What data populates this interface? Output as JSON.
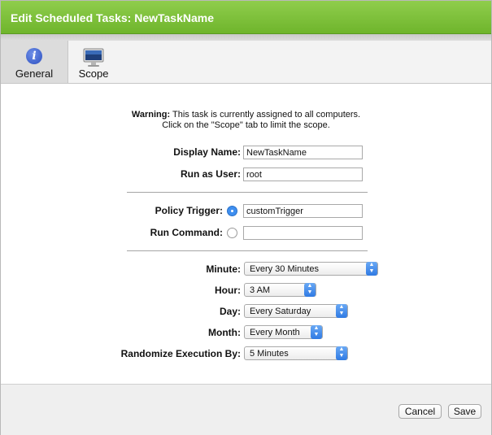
{
  "window": {
    "title": "Edit Scheduled Tasks: NewTaskName"
  },
  "tabs": [
    {
      "label": "General",
      "icon": "info-icon",
      "active": true
    },
    {
      "label": "Scope",
      "icon": "monitor-icon",
      "active": false
    }
  ],
  "warning": {
    "prefix": "Warning:",
    "line1": " This task is currently assigned to all computers.",
    "line2": "Click on the \"Scope\" tab to limit the scope."
  },
  "form": {
    "display_name": {
      "label": "Display Name:",
      "value": "NewTaskName"
    },
    "run_as_user": {
      "label": "Run as User:",
      "value": "root"
    },
    "policy_trigger": {
      "label": "Policy Trigger:",
      "value": "customTrigger",
      "selected": true
    },
    "run_command": {
      "label": "Run Command:",
      "value": "",
      "selected": false
    },
    "minute": {
      "label": "Minute:",
      "value": "Every 30 Minutes"
    },
    "hour": {
      "label": "Hour:",
      "value": "3 AM"
    },
    "day": {
      "label": "Day:",
      "value": "Every Saturday"
    },
    "month": {
      "label": "Month:",
      "value": "Every Month"
    },
    "randomize": {
      "label": "Randomize Execution By:",
      "value": "5 Minutes"
    }
  },
  "footer": {
    "cancel_label": "Cancel",
    "save_label": "Save"
  },
  "colors": {
    "title_bar": "#7cc13a",
    "radio_selected": "#3f8ff0",
    "select_arrow": "#2f7ae3"
  }
}
